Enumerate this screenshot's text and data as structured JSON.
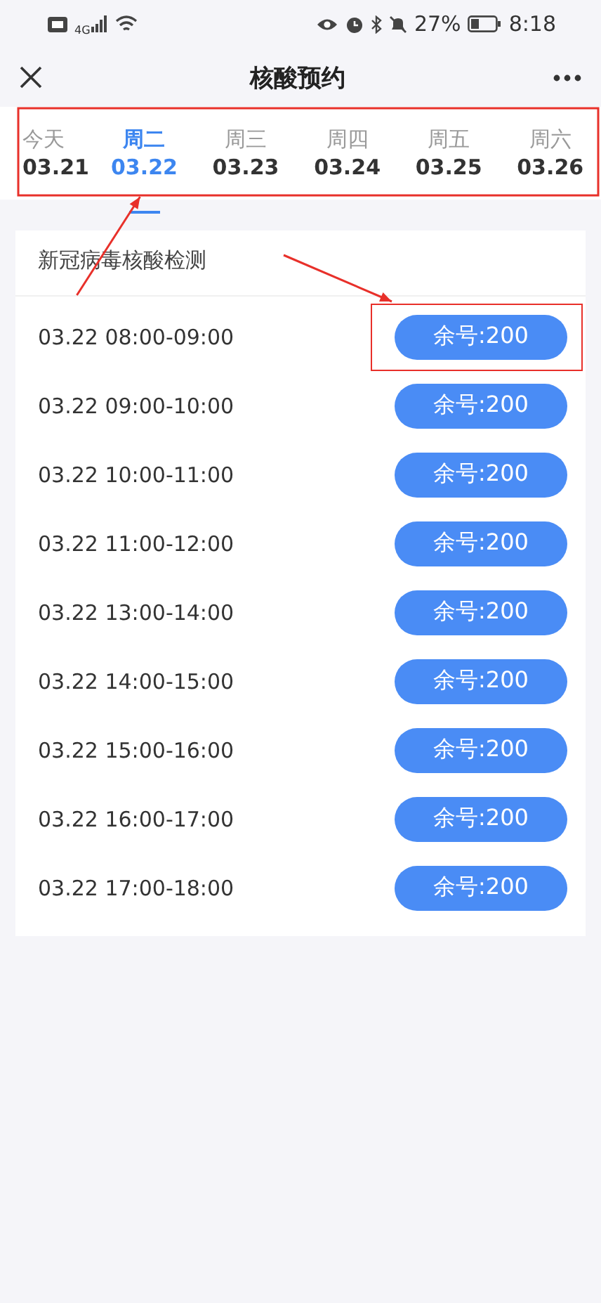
{
  "status_bar": {
    "network": "4G",
    "battery": "27%",
    "time": "8:18"
  },
  "header": {
    "title": "核酸预约"
  },
  "date_tabs": {
    "highlighted": true,
    "tabs": [
      {
        "weekday": "今天",
        "date": "03.21",
        "selected": false
      },
      {
        "weekday": "周二",
        "date": "03.22",
        "selected": true
      },
      {
        "weekday": "周三",
        "date": "03.23",
        "selected": false
      },
      {
        "weekday": "周四",
        "date": "03.24",
        "selected": false
      },
      {
        "weekday": "周五",
        "date": "03.25",
        "selected": false
      },
      {
        "weekday": "周六",
        "date": "03.26",
        "selected": false
      }
    ]
  },
  "card": {
    "title": "新冠病毒核酸检测",
    "slots": [
      {
        "time": "03.22 08:00-09:00",
        "button": "余号:200",
        "highlighted": true
      },
      {
        "time": "03.22 09:00-10:00",
        "button": "余号:200",
        "highlighted": false
      },
      {
        "time": "03.22 10:00-11:00",
        "button": "余号:200",
        "highlighted": false
      },
      {
        "time": "03.22 11:00-12:00",
        "button": "余号:200",
        "highlighted": false
      },
      {
        "time": "03.22 13:00-14:00",
        "button": "余号:200",
        "highlighted": false
      },
      {
        "time": "03.22 14:00-15:00",
        "button": "余号:200",
        "highlighted": false
      },
      {
        "time": "03.22 15:00-16:00",
        "button": "余号:200",
        "highlighted": false
      },
      {
        "time": "03.22 16:00-17:00",
        "button": "余号:200",
        "highlighted": false
      },
      {
        "time": "03.22 17:00-18:00",
        "button": "余号:200",
        "highlighted": false
      }
    ]
  }
}
